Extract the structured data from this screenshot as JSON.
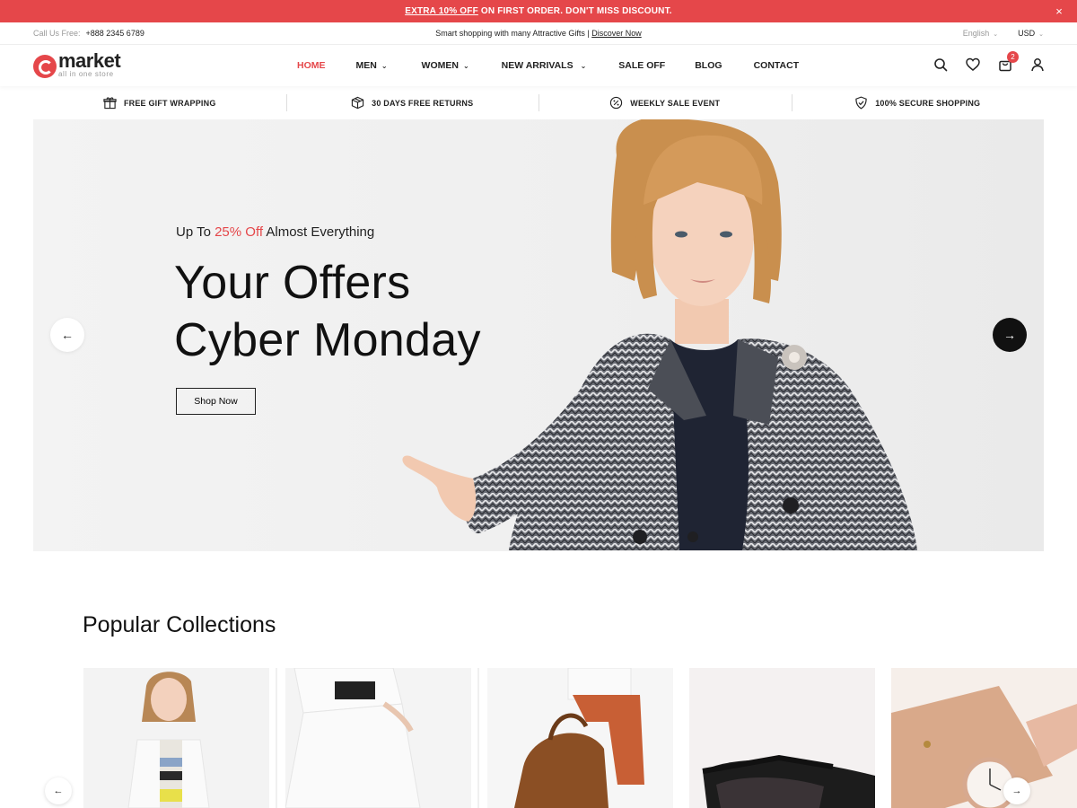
{
  "promo": {
    "highlight": "EXTRA 10% OFF",
    "rest": " ON FIRST ORDER. DON'T MISS DISCOUNT.",
    "close": "×"
  },
  "topbar": {
    "call_label": "Call Us Free:",
    "phone": "+888 2345 6789",
    "tagline": "Smart shopping with many Attractive Gifts |",
    "tagline_link": "Discover Now",
    "language": "English",
    "currency": "USD"
  },
  "logo": {
    "name": "market",
    "tag": "all in one store"
  },
  "nav": {
    "home": "HOME",
    "men": "MEN",
    "women": "WOMEN",
    "new_arrivals": "NEW ARRIVALS",
    "sale_off": "SALE OFF",
    "blog": "BLOG",
    "contact": "CONTACT"
  },
  "cart_count": "2",
  "features": {
    "gift": "FREE GIFT WRAPPING",
    "returns": "30 DAYS FREE RETURNS",
    "sale": "WEEKLY SALE EVENT",
    "secure": "100% SECURE SHOPPING"
  },
  "hero": {
    "kicker_pre": "Up To ",
    "kicker_pct": "25% Off",
    "kicker_post": " Almost Everything",
    "title_line1": "Your Offers",
    "title_line2": "Cyber Monday",
    "cta": "Shop Now"
  },
  "collections": {
    "title": "Popular Collections"
  },
  "colors": {
    "accent": "#e5474a",
    "dark": "#111111"
  }
}
